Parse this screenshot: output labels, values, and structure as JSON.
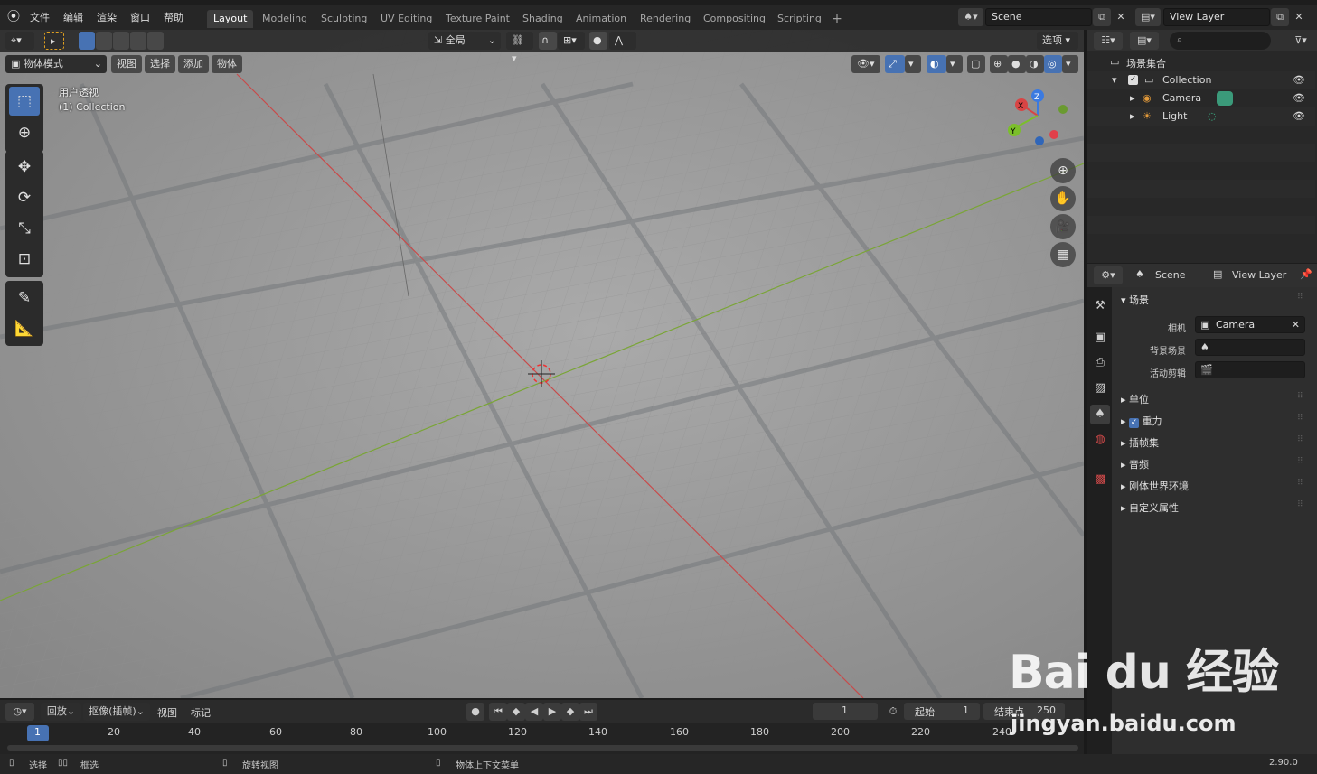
{
  "menu": {
    "file": "文件",
    "edit": "编辑",
    "render": "渲染",
    "window": "窗口",
    "help": "帮助"
  },
  "workspaces": [
    "Layout",
    "Modeling",
    "Sculpting",
    "UV Editing",
    "Texture Paint",
    "Shading",
    "Animation",
    "Rendering",
    "Compositing",
    "Scripting"
  ],
  "scene": {
    "name": "Scene"
  },
  "view_layer": {
    "name": "View Layer"
  },
  "viewport": {
    "transform_orientation": "全局",
    "options_label": "选项",
    "mode": "物体模式",
    "menus": [
      "视图",
      "选择",
      "添加",
      "物体"
    ],
    "overlay_line1": "用户透视",
    "overlay_line2": "(1) Collection",
    "gizmo_axes": {
      "x": "X",
      "y": "Y",
      "z": "Z"
    }
  },
  "outliner": {
    "root": "场景集合",
    "collection": "Collection",
    "items": [
      "Camera",
      "Light"
    ]
  },
  "properties": {
    "header_scene": "Scene",
    "header_view_layer": "View Layer",
    "panel_title": "场景",
    "camera_label": "相机",
    "camera_value": "Camera",
    "background_label": "背景场景",
    "clip_label": "活动剪辑",
    "sub_panels": [
      "单位",
      "重力",
      "插帧集",
      "音频",
      "刚体世界环境",
      "自定义属性"
    ]
  },
  "timeline": {
    "playback": "回放",
    "keying": "抠像(插帧)",
    "view": "视图",
    "marker": "标记",
    "current_frame": "1",
    "start_label": "起始",
    "start_value": "1",
    "end_label": "结束点",
    "end_value": "250",
    "ruler": [
      "1",
      "20",
      "40",
      "60",
      "80",
      "100",
      "120",
      "140",
      "160",
      "180",
      "200",
      "220",
      "240"
    ]
  },
  "status": {
    "select": "选择",
    "box_select": "框选",
    "rotate_view": "旋转视图",
    "context_menu": "物体上下文菜单",
    "version": "2.90.0"
  },
  "watermark": {
    "brand": "Bai du 经验",
    "url": "jingyan.baidu.com"
  },
  "colors": {
    "accent": "#4772b3",
    "x_axis": "#c84a4a",
    "y_axis": "#7aa536"
  }
}
